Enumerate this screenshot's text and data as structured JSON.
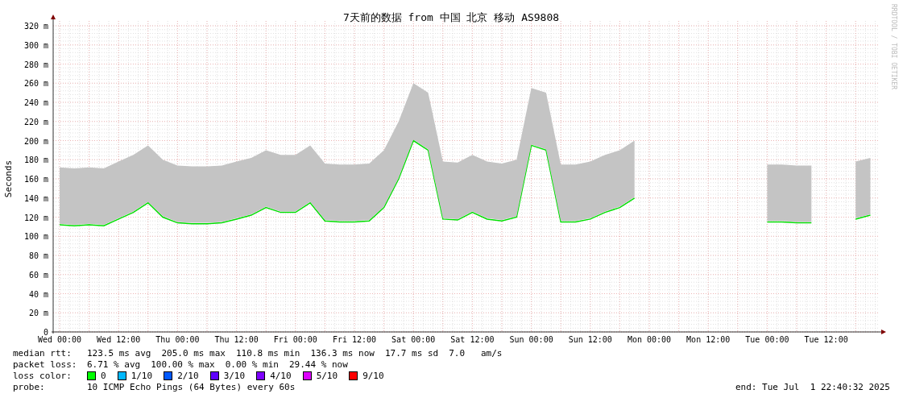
{
  "chart": {
    "credit": "RRDTOOL / TOBI OETIKER",
    "chart_data": {
      "type": "line",
      "title": "7天前的数据 from 中国 北京 移动 AS9808",
      "ylabel": "Seconds",
      "grid": true,
      "categories": [
        "Wed 00:00",
        null,
        null,
        null,
        "Wed 12:00",
        null,
        null,
        null,
        "Thu 00:00",
        null,
        null,
        null,
        "Thu 12:00",
        null,
        null,
        null,
        "Fri 00:00",
        null,
        null,
        null,
        "Fri 12:00",
        null,
        null,
        null,
        "Sat 00:00",
        null,
        null,
        null,
        "Sat 12:00",
        null,
        null,
        null,
        "Sun 00:00",
        null,
        null,
        null,
        "Sun 12:00",
        null,
        null,
        null,
        "Mon 00:00",
        null,
        null,
        null,
        "Mon 12:00",
        null,
        null,
        null,
        "Tue 00:00",
        null,
        null,
        null,
        "Tue 12:00",
        null,
        null,
        null
      ],
      "series": [
        {
          "color": "#00e000",
          "values": [
            112,
            111,
            112,
            111,
            118,
            125,
            135,
            120,
            114,
            113,
            113,
            114,
            118,
            122,
            130,
            125,
            125,
            135,
            116,
            115,
            115,
            116,
            130,
            160,
            200,
            190,
            118,
            117,
            125,
            118,
            116,
            120,
            195,
            190,
            115,
            115,
            118,
            125,
            130,
            140,
            null,
            null,
            null,
            null,
            null,
            null,
            null,
            null,
            115,
            115,
            114,
            114,
            null,
            null,
            118,
            122
          ]
        }
      ],
      "ylim": [
        0,
        320
      ],
      "yticks": [
        {
          "value": 0,
          "label": "0"
        },
        {
          "value": 20,
          "label": "20 m"
        },
        {
          "value": 40,
          "label": "40 m"
        },
        {
          "value": 60,
          "label": "60 m"
        },
        {
          "value": 80,
          "label": "80 m"
        },
        {
          "value": 100,
          "label": "100 m"
        },
        {
          "value": 120,
          "label": "120 m"
        },
        {
          "value": 140,
          "label": "140 m"
        },
        {
          "value": 160,
          "label": "160 m"
        },
        {
          "value": 180,
          "label": "180 m"
        },
        {
          "value": 200,
          "label": "200 m"
        },
        {
          "value": 220,
          "label": "220 m"
        },
        {
          "value": 240,
          "label": "240 m"
        },
        {
          "value": 260,
          "label": "260 m"
        },
        {
          "value": 280,
          "label": "280 m"
        },
        {
          "value": 300,
          "label": "300 m"
        },
        {
          "value": 320,
          "label": "320 m"
        }
      ]
    }
  },
  "legend": {
    "stats": [
      {
        "label": "median rtt:",
        "values": [
          "123.5 ms avg",
          "205.0 ms max",
          "110.8 ms min",
          "136.3 ms now",
          "17.7 ms sd",
          "7.0   am/s"
        ]
      },
      {
        "label": "packet loss:",
        "values": [
          "6.71 % avg",
          "100.00 % max",
          "0.00 % min",
          "29.44 % now"
        ]
      }
    ],
    "loss_label": "loss color:",
    "loss_colors": [
      {
        "label": "0",
        "color": "#00ff00"
      },
      {
        "label": "1/10",
        "color": "#00b8ff"
      },
      {
        "label": "2/10",
        "color": "#0059ff"
      },
      {
        "label": "3/10",
        "color": "#5e00ff"
      },
      {
        "label": "4/10",
        "color": "#7e00ff"
      },
      {
        "label": "5/10",
        "color": "#dd00ff"
      },
      {
        "label": "9/10",
        "color": "#ff0000"
      }
    ],
    "probe_label": "probe:",
    "probe": "10 ICMP Echo Pings (64 Bytes) every 60s",
    "end": "end: Tue Jul  1 22:40:32 2025"
  }
}
